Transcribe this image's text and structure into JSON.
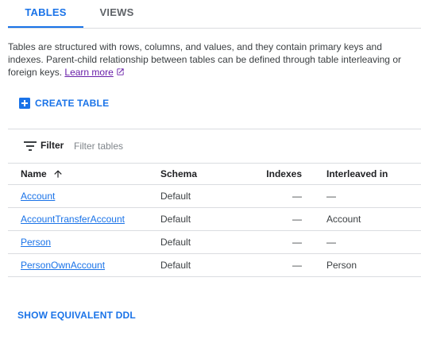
{
  "tabs": [
    {
      "label": "TABLES",
      "active": true
    },
    {
      "label": "VIEWS",
      "active": false
    }
  ],
  "description": {
    "text": "Tables are structured with rows, columns, and values, and they contain primary keys and indexes. Parent-child relationship between tables can be defined through table interleaving or foreign keys.",
    "link_label": "Learn more"
  },
  "create_table": {
    "label": "CREATE TABLE"
  },
  "filter": {
    "label": "Filter",
    "placeholder": "Filter tables",
    "value": ""
  },
  "table": {
    "columns": [
      "Name",
      "Schema",
      "Indexes",
      "Interleaved in"
    ],
    "sort": {
      "column": "Name",
      "direction": "ascending"
    },
    "rows": [
      {
        "name": "Account",
        "schema": "Default",
        "indexes": "—",
        "interleaved_in": "—"
      },
      {
        "name": "AccountTransferAccount",
        "schema": "Default",
        "indexes": "—",
        "interleaved_in": "Account"
      },
      {
        "name": "Person",
        "schema": "Default",
        "indexes": "—",
        "interleaved_in": "—"
      },
      {
        "name": "PersonOwnAccount",
        "schema": "Default",
        "indexes": "—",
        "interleaved_in": "Person"
      }
    ]
  },
  "ddl_button": {
    "label": "SHOW EQUIVALENT DDL"
  },
  "colors": {
    "accent": "#1a73e8",
    "visited_link": "#681da8",
    "divider": "#dadce0"
  },
  "icons": {
    "create": "add-box-icon",
    "filter": "filter-list-icon",
    "sort": "arrow-upward-icon",
    "external": "open-in-new-icon"
  }
}
